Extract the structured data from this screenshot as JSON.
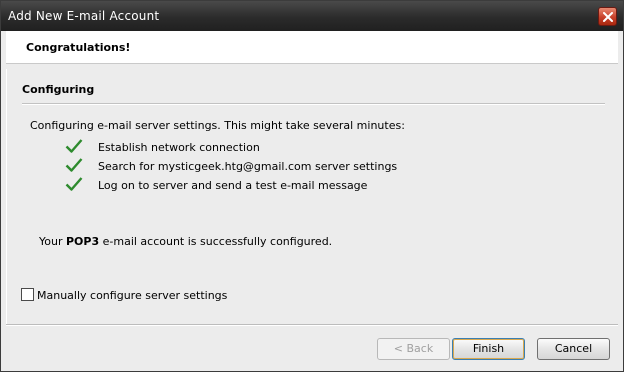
{
  "window": {
    "title": "Add New E-mail Account"
  },
  "header": {
    "title": "Congratulations!"
  },
  "section": {
    "title": "Configuring",
    "intro": "Configuring e-mail server settings. This might take several minutes:"
  },
  "steps": [
    {
      "label": "Establish network connection",
      "status": "done"
    },
    {
      "label": "Search for mysticgeek.htg@gmail.com server settings",
      "status": "done"
    },
    {
      "label": "Log on to server and send a test e-mail message",
      "status": "done"
    }
  ],
  "result": {
    "prefix": "Your ",
    "protocol": "POP3",
    "suffix": " e-mail account is successfully configured."
  },
  "manual": {
    "label": "Manually configure server settings",
    "checked": false
  },
  "buttons": {
    "back": "< Back",
    "finish": "Finish",
    "cancel": "Cancel"
  },
  "colors": {
    "check": "#2e8b2e",
    "titlebar": "#2b2b2b",
    "close": "#c8402a"
  }
}
